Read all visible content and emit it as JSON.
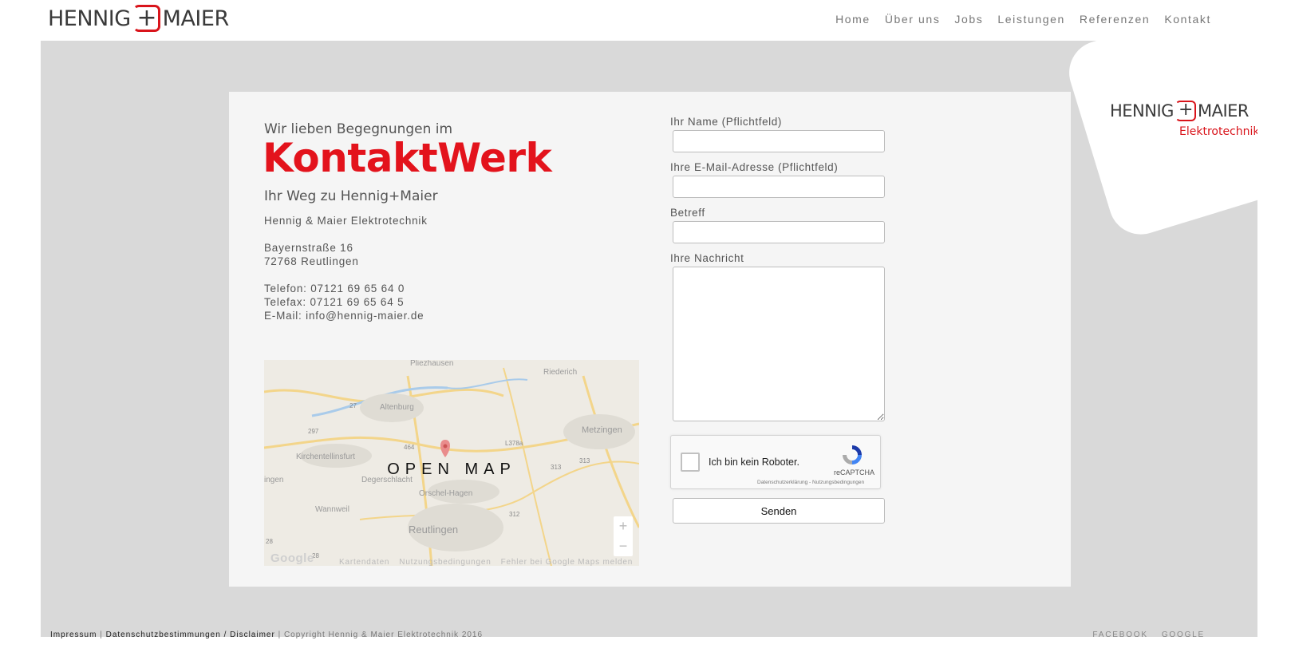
{
  "header": {
    "logo_left": "HENNIG",
    "logo_plus": "+",
    "logo_right": "MAIER",
    "nav": [
      "Home",
      "Über uns",
      "Jobs",
      "Leistungen",
      "Referenzen",
      "Kontakt"
    ]
  },
  "badge": {
    "logo_left": "HENNIG",
    "logo_plus": "+",
    "logo_right": "MAIER",
    "subtitle": "Elektrotechnik"
  },
  "contact": {
    "intro": "Wir lieben Begegnungen im",
    "headline": "KontaktWerk",
    "subheadline": "Ihr Weg zu Hennig+Maier",
    "company": "Hennig & Maier Elektrotechnik",
    "street": "Bayernstraße 16",
    "city": "72768 Reutlingen",
    "phone": "Telefon: 07121 69 65 64 0",
    "fax": "Telefax: 07121 69 65 64 5",
    "email": "E-Mail: info@hennig-maier.de"
  },
  "map": {
    "open_label": "OPEN MAP",
    "places": [
      "Pliezhausen",
      "Riederich",
      "Altenburg",
      "Metzingen",
      "Kirchentellinsfurt",
      "Degerschlacht",
      "Orschel-Hagen",
      "Wannweil",
      "Reutlingen",
      "ingen"
    ],
    "roads": [
      "27",
      "297",
      "464",
      "L378a",
      "313",
      "313",
      "312",
      "28",
      "28"
    ],
    "zoom_in": "+",
    "zoom_out": "−",
    "google": "Google",
    "footer_links": [
      "Kartendaten",
      "Nutzungsbedingungen",
      "Fehler bei Google Maps melden"
    ]
  },
  "form": {
    "name_label": "Ihr Name (Pflichtfeld)",
    "email_label": "Ihre E-Mail-Adresse (Pflichtfeld)",
    "subject_label": "Betreff",
    "message_label": "Ihre Nachricht",
    "name_value": "",
    "email_value": "",
    "subject_value": "",
    "message_value": "",
    "recaptcha_text": "Ich bin kein Roboter.",
    "recaptcha_brand": "reCAPTCHA",
    "recaptcha_terms": "Datenschutzerklärung - Nutzungsbedingungen",
    "send_label": "Senden"
  },
  "footer": {
    "impressum": "Impressum",
    "sep1": " | ",
    "privacy": "Datenschutzbestimmungen / Disclaimer",
    "copyright": " | Copyright Hennig & Maier Elektrotechnik 2016",
    "social": [
      "FACEBOOK",
      "GOOGLE"
    ]
  },
  "colors": {
    "accent": "#e3131c",
    "stage_bg": "#d9d9d9",
    "card_bg": "#f5f5f5"
  }
}
